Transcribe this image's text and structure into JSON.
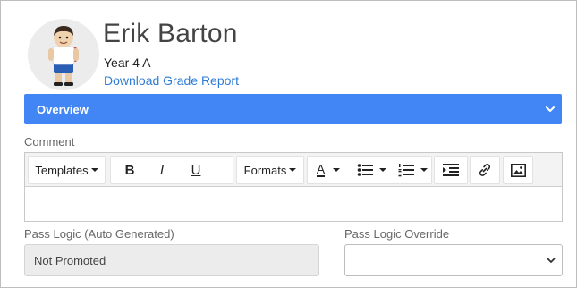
{
  "student": {
    "name": "Erik Barton",
    "class": "Year 4 A",
    "download_link": "Download Grade Report"
  },
  "overview": {
    "title": "Overview"
  },
  "comment": {
    "label": "Comment",
    "toolbar": {
      "templates_label": "Templates",
      "formats_label": "Formats",
      "bold_label": "B",
      "italic_label": "I",
      "underline_label": "U",
      "font_color_label": "A"
    },
    "value": ""
  },
  "pass_logic": {
    "label": "Pass Logic (Auto Generated)",
    "value": "Not Promoted"
  },
  "pass_logic_override": {
    "label": "Pass Logic Override",
    "value": ""
  },
  "colors": {
    "accent": "#4285f4",
    "link": "#2f7bd6"
  },
  "icons": [
    "chevron-down-icon",
    "bullet-list-icon",
    "numbered-list-icon",
    "indent-icon",
    "link-icon",
    "image-icon"
  ]
}
